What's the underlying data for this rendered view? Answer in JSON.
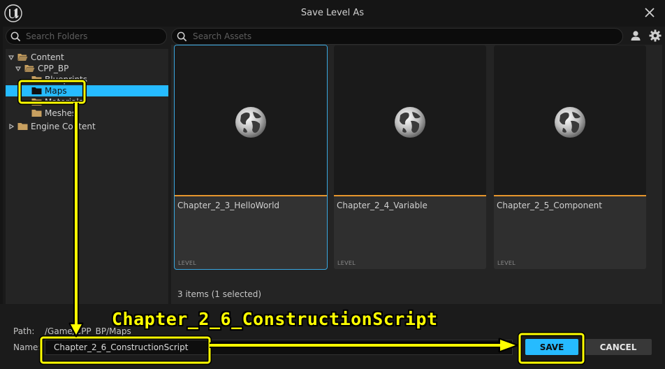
{
  "window": {
    "title": "Save Level As"
  },
  "folder_search": {
    "placeholder": "Search Folders"
  },
  "asset_search": {
    "placeholder": "Search Assets"
  },
  "folder_tree": [
    {
      "label": "Content",
      "level": 0,
      "expanded": true,
      "selected": false
    },
    {
      "label": "CPP_BP",
      "level": 1,
      "expanded": true,
      "selected": false
    },
    {
      "label": "Blueprints",
      "level": 2,
      "expanded": false,
      "selected": false
    },
    {
      "label": "Maps",
      "level": 2,
      "expanded": false,
      "selected": true
    },
    {
      "label": "Materials",
      "level": 2,
      "expanded": false,
      "selected": false
    },
    {
      "label": "Meshes",
      "level": 2,
      "expanded": false,
      "selected": false
    },
    {
      "label": "Engine Content",
      "level": 0,
      "expanded": false,
      "selected": false
    }
  ],
  "assets": [
    {
      "name": "Chapter_2_3_HelloWorld",
      "type": "LEVEL",
      "selected": true
    },
    {
      "name": "Chapter_2_4_Variable",
      "type": "LEVEL",
      "selected": false
    },
    {
      "name": "Chapter_2_5_Component",
      "type": "LEVEL",
      "selected": false
    }
  ],
  "items_count": "3 items (1 selected)",
  "path": {
    "label": "Path:",
    "value": "/Game/CPP_BP/Maps"
  },
  "name": {
    "label": "Name:",
    "value": "Chapter_2_6_ConstructionScript"
  },
  "buttons": {
    "save": "SAVE",
    "cancel": "CANCEL"
  },
  "annotation": {
    "text": "Chapter_2_6_ConstructionScript"
  },
  "colors": {
    "accent": "#26bbff",
    "annotation": "#ffff00",
    "level_strip": "#e6962d",
    "folder": "#c8a060"
  }
}
